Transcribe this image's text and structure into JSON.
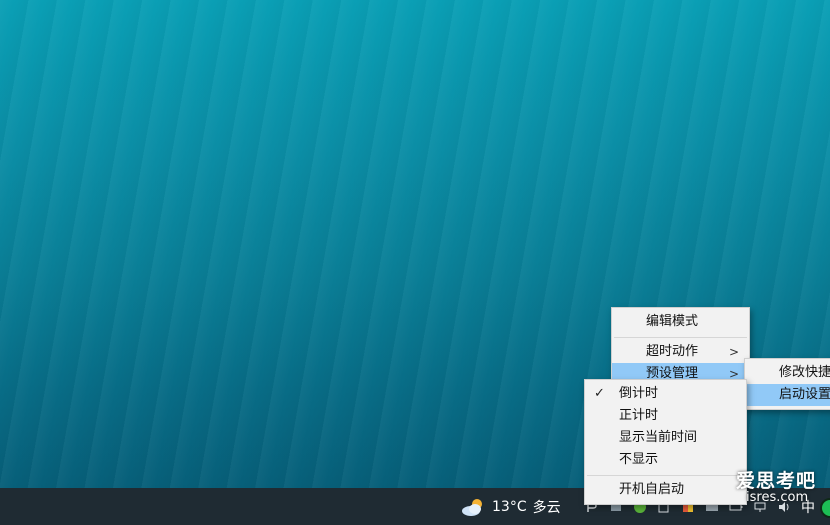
{
  "main_menu": {
    "items": [
      {
        "label": "编辑模式"
      },
      {
        "label": "超时动作",
        "arrow": ">"
      },
      {
        "label": "预设管理",
        "arrow": ">"
      }
    ]
  },
  "preset_menu": {
    "items": [
      {
        "label": "修改快捷时"
      },
      {
        "label": "启动设置"
      }
    ]
  },
  "display_menu": {
    "items": [
      {
        "label": "倒计时",
        "check": "✓"
      },
      {
        "label": "正计时"
      },
      {
        "label": "显示当前时间"
      },
      {
        "label": "不显示"
      },
      {
        "label": "开机自启动"
      }
    ]
  },
  "taskbar": {
    "temperature": "13°C",
    "weather_text": "多云",
    "ime": "中"
  },
  "watermark": {
    "text": "爱思考吧",
    "sub": "isres.com"
  }
}
